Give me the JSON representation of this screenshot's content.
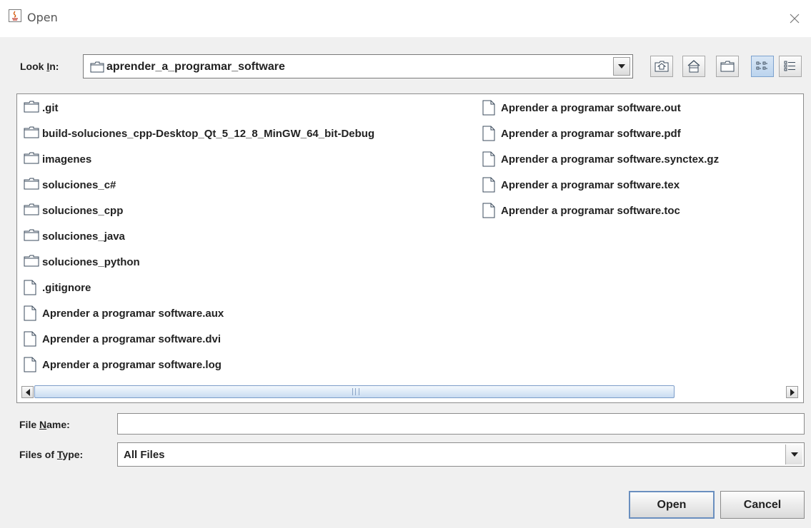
{
  "window": {
    "title": "Open"
  },
  "look_in": {
    "label_prefix": "Look ",
    "label_mnemonic": "I",
    "label_suffix": "n:",
    "value": "aprender_a_programar_software"
  },
  "toolbar": {
    "buttons": [
      {
        "name": "up-one-level-icon"
      },
      {
        "name": "home-icon"
      },
      {
        "name": "new-folder-icon"
      },
      {
        "name": "list-view-icon"
      },
      {
        "name": "details-view-icon"
      }
    ]
  },
  "files": {
    "column1": [
      {
        "name": ".git",
        "type": "folder"
      },
      {
        "name": "build-soluciones_cpp-Desktop_Qt_5_12_8_MinGW_64_bit-Debug",
        "type": "folder"
      },
      {
        "name": "imagenes",
        "type": "folder"
      },
      {
        "name": "soluciones_c#",
        "type": "folder"
      },
      {
        "name": "soluciones_cpp",
        "type": "folder"
      },
      {
        "name": "soluciones_java",
        "type": "folder"
      },
      {
        "name": "soluciones_python",
        "type": "folder"
      },
      {
        "name": ".gitignore",
        "type": "file"
      },
      {
        "name": "Aprender a programar software.aux",
        "type": "file"
      },
      {
        "name": "Aprender a programar software.dvi",
        "type": "file"
      },
      {
        "name": "Aprender a programar software.log",
        "type": "file"
      }
    ],
    "column2": [
      {
        "name": "Aprender a programar software.out",
        "type": "file"
      },
      {
        "name": "Aprender a programar software.pdf",
        "type": "file"
      },
      {
        "name": "Aprender a programar software.synctex.gz",
        "type": "file"
      },
      {
        "name": "Aprender a programar software.tex",
        "type": "file"
      },
      {
        "name": "Aprender a programar software.toc",
        "type": "file"
      }
    ]
  },
  "file_name": {
    "label_prefix": "File ",
    "label_mnemonic": "N",
    "label_suffix": "ame:",
    "value": ""
  },
  "files_of_type": {
    "label_prefix": "Files of ",
    "label_mnemonic": "T",
    "label_suffix": "ype:",
    "value": "All Files"
  },
  "buttons": {
    "open": "Open",
    "cancel": "Cancel"
  }
}
